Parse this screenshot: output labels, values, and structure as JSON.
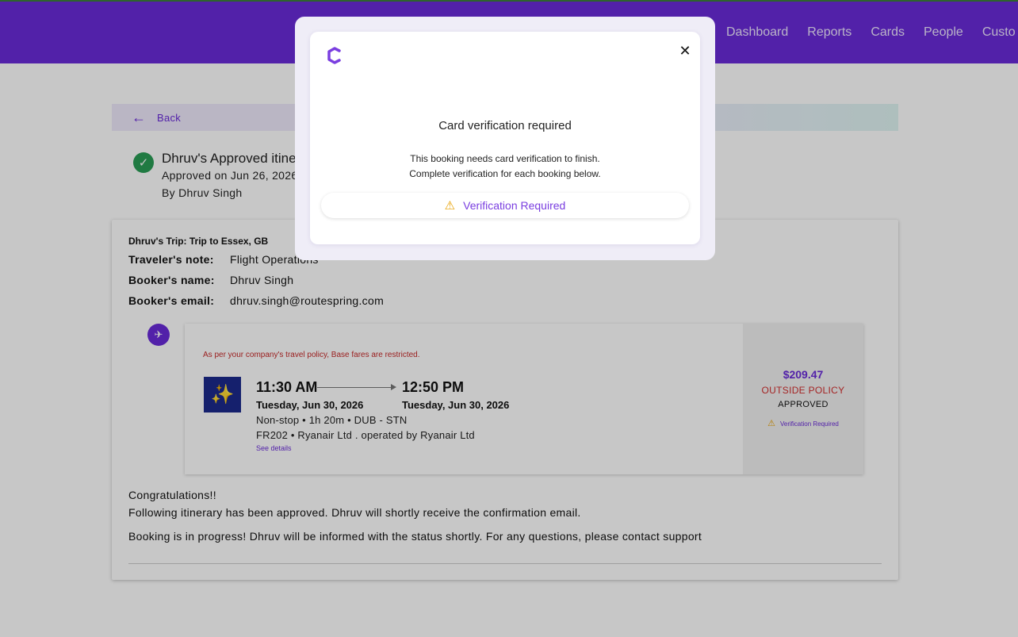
{
  "nav": {
    "items": [
      "Dashboard",
      "Reports",
      "Cards",
      "People",
      "Custo"
    ]
  },
  "back": {
    "label": "Back"
  },
  "approval": {
    "title": "Dhruv's Approved itinerary",
    "approved_on": "Approved on Jun 26, 2026",
    "approved_by": "By Dhruv Singh"
  },
  "trip": {
    "title": "Dhruv's Trip: Trip to Essex, GB",
    "traveler_note_label": "Traveler's note:",
    "traveler_note_value": "Flight Operations",
    "booker_name_label": "Booker's name:",
    "booker_name_value": "Dhruv Singh",
    "booker_email_label": "Booker's email:",
    "booker_email_value": "dhruv.singh@routespring.com"
  },
  "flight": {
    "policy_note": "As per your company's travel policy, Base fares are restricted.",
    "depart_time": "11:30 AM",
    "arrive_time": "12:50 PM",
    "depart_date": "Tuesday, Jun 30, 2026",
    "arrive_date": "Tuesday, Jun 30, 2026",
    "meta": "Non-stop • 1h 20m • DUB - STN",
    "carrier": "FR202 • Ryanair Ltd . operated by Ryanair Ltd",
    "see_details": "See details",
    "price": "$209.47",
    "policy_status": "OUTSIDE POLICY",
    "approval_status": "APPROVED",
    "verification": "Verification Required"
  },
  "messages": {
    "congrats": "Congratulations!!",
    "approved_line": "Following itinerary has been approved. Dhruv will shortly receive the confirmation email.",
    "progress": "Booking is in progress! Dhruv will be informed with the status shortly. For any questions, please contact support"
  },
  "modal": {
    "title": "Card verification required",
    "body_line1": "This booking needs card verification to finish.",
    "body_line2": "Complete verification for each booking below.",
    "button_label": "Verification Required",
    "close_icon": "close-icon",
    "brand_icon": "brand-logo"
  },
  "colors": {
    "brand": "#6a2bd9",
    "danger": "#d32f2f",
    "warning": "#e8a000",
    "success": "#2a9d55"
  }
}
